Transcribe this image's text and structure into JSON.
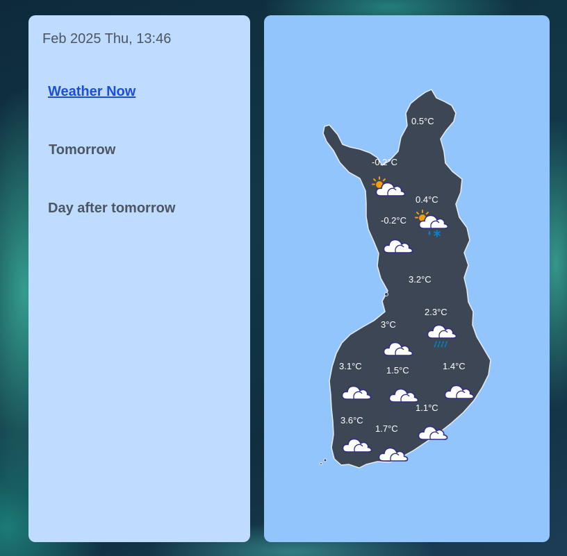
{
  "header": {
    "datetime": "Feb 2025 Thu, 13:46"
  },
  "nav": {
    "items": [
      {
        "label": "Weather Now",
        "active": true
      },
      {
        "label": "Tomorrow",
        "active": false
      },
      {
        "label": "Day after tomorrow",
        "active": false
      }
    ]
  },
  "map": {
    "region": "Finland",
    "stations": [
      {
        "temp": "0.5°C",
        "icon": "none"
      },
      {
        "temp": "-0.2°C",
        "icon": "partly-cloudy-icon"
      },
      {
        "temp": "0.4°C",
        "icon": "partly-cloudy-sleet-icon"
      },
      {
        "temp": "-0.2°C",
        "icon": "cloudy-icon"
      },
      {
        "temp": "3.2°C",
        "icon": "none"
      },
      {
        "temp": "2.3°C",
        "icon": "rain-cloud-icon"
      },
      {
        "temp": "3°C",
        "icon": "cloudy-icon"
      },
      {
        "temp": "3.1°C",
        "icon": "cloudy-icon"
      },
      {
        "temp": "1.5°C",
        "icon": "cloudy-icon"
      },
      {
        "temp": "1.4°C",
        "icon": "cloudy-icon"
      },
      {
        "temp": "1.1°C",
        "icon": "cloudy-icon"
      },
      {
        "temp": "3.6°C",
        "icon": "cloudy-icon"
      },
      {
        "temp": "1.7°C",
        "icon": "cloudy-icon"
      }
    ]
  },
  "colors": {
    "page_background": "#123848",
    "sidebar_background": "#bfdcfe",
    "map_panel_background": "#93c5fd",
    "map_land": "#3d4654",
    "active_link": "#1d4ed8",
    "text": "#4b5563",
    "sun": "#f59e0b",
    "precip": "#0284c7",
    "cloud_outline": "#312e81"
  }
}
